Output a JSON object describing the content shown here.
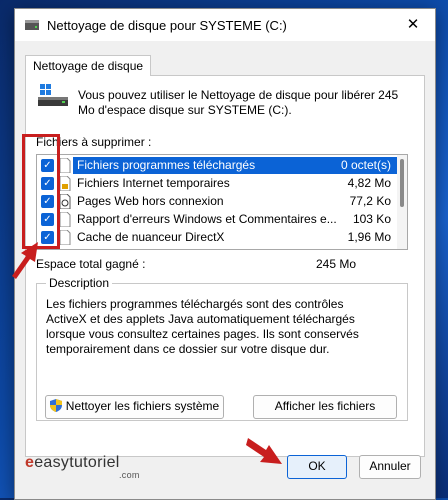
{
  "window": {
    "title": "Nettoyage de disque pour SYSTEME (C:)",
    "close_glyph": "✕"
  },
  "tab": {
    "label": "Nettoyage de disque"
  },
  "intro": {
    "text": "Vous pouvez utiliser le Nettoyage de disque pour libérer 245 Mo d'espace disque sur SYSTEME (C:)."
  },
  "files_label": "Fichiers à supprimer :",
  "files": [
    {
      "name": "Fichiers programmes téléchargés",
      "size": "0 octet(s)",
      "checked": true,
      "selected": true
    },
    {
      "name": "Fichiers Internet temporaires",
      "size": "4,82 Mo",
      "checked": true,
      "selected": false
    },
    {
      "name": "Pages Web hors connexion",
      "size": "77,2 Ko",
      "checked": true,
      "selected": false
    },
    {
      "name": "Rapport d'erreurs Windows et Commentaires e...",
      "size": "103 Ko",
      "checked": true,
      "selected": false
    },
    {
      "name": "Cache de nuanceur DirectX",
      "size": "1,96 Mo",
      "checked": true,
      "selected": false
    }
  ],
  "total": {
    "label": "Espace total gagné :",
    "value": "245 Mo"
  },
  "description": {
    "title": "Description",
    "text": "Les fichiers programmes téléchargés sont des contrôles ActiveX et des applets Java automatiquement téléchargés lorsque vous consultez certaines pages. Ils sont conservés temporairement dans ce dossier sur votre disque dur."
  },
  "buttons": {
    "clean_system": "Nettoyer les fichiers système",
    "show_files": "Afficher les fichiers",
    "ok": "OK",
    "cancel": "Annuler"
  },
  "watermark": {
    "brand": "easytutoriel",
    "suffix": ".com"
  },
  "colors": {
    "accent": "#0b63d6",
    "annotation": "#c81e1e"
  },
  "icons": [
    "drive-icon",
    "shield-icon",
    "file-icon",
    "close-icon",
    "checkbox-icon"
  ]
}
